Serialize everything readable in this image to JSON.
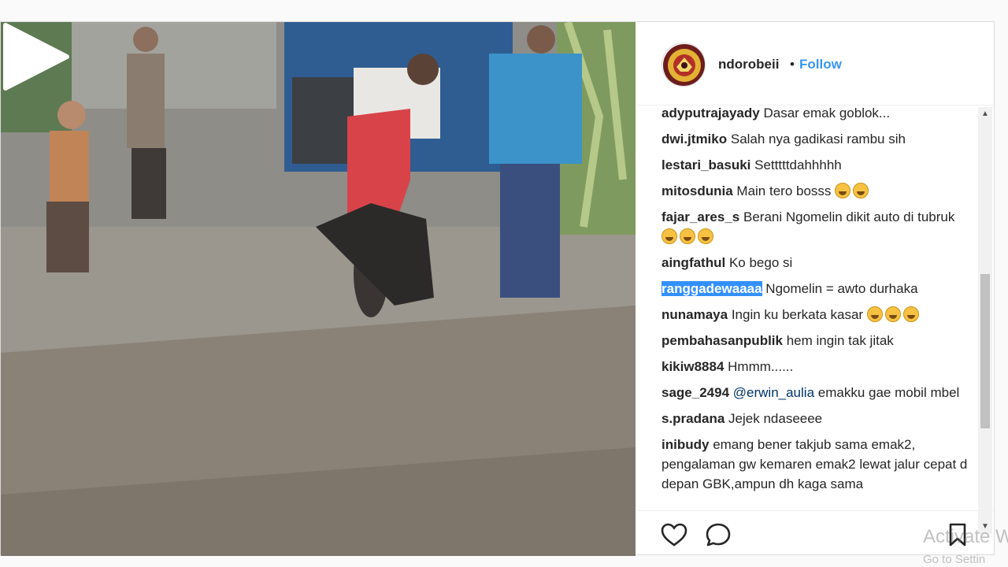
{
  "post": {
    "username": "ndorobeii",
    "separator": "•",
    "follow_label": "Follow"
  },
  "comments": [
    {
      "user": "adyputrajayady",
      "text": "Dasar emak goblok..."
    },
    {
      "user": "dwi.jtmiko",
      "text": "Salah nya gadikasi rambu sih"
    },
    {
      "user": "lestari_basuki",
      "text": "Setttttdahhhhh"
    },
    {
      "user": "mitosdunia",
      "text": "Main tero bosss",
      "emoji_count": 2
    },
    {
      "user": "fajar_ares_s",
      "text": "Berani Ngomelin dikit auto di tubruk",
      "emoji_count": 3
    },
    {
      "user": "aingfathul",
      "text": "Ko bego si"
    },
    {
      "user": "ranggadewaaaa",
      "text": "Ngomelin = awto durhaka",
      "selected": true
    },
    {
      "user": "nunamaya",
      "text": "Ingin ku berkata kasar",
      "emoji_count": 3
    },
    {
      "user": "pembahasanpublik",
      "text": "hem ingin tak jitak"
    },
    {
      "user": "kikiw8884",
      "text": "Hmmm......"
    },
    {
      "user": "sage_2494",
      "mention": "@erwin_aulia",
      "text": "emakku gae mobil mbel"
    },
    {
      "user": "s.pradana",
      "text": "Jejek ndaseeee"
    },
    {
      "user": "inibudy",
      "text": "emang bener takjub sama emak2, pengalaman gw kemaren emak2 lewat jalur cepat d depan GBK,ampun dh kaga sama"
    }
  ],
  "icons": {
    "play": "play-icon",
    "like": "heart-icon",
    "comment": "comment-icon",
    "save": "bookmark-icon",
    "scroll_up": "scroll-up-icon",
    "scroll_down": "scroll-down-icon"
  },
  "watermark": {
    "line1": "Activate W",
    "line2": "Go to Settin"
  },
  "colors": {
    "follow": "#3897f0",
    "selection": "#3390ff",
    "border": "#dbdbdb"
  }
}
